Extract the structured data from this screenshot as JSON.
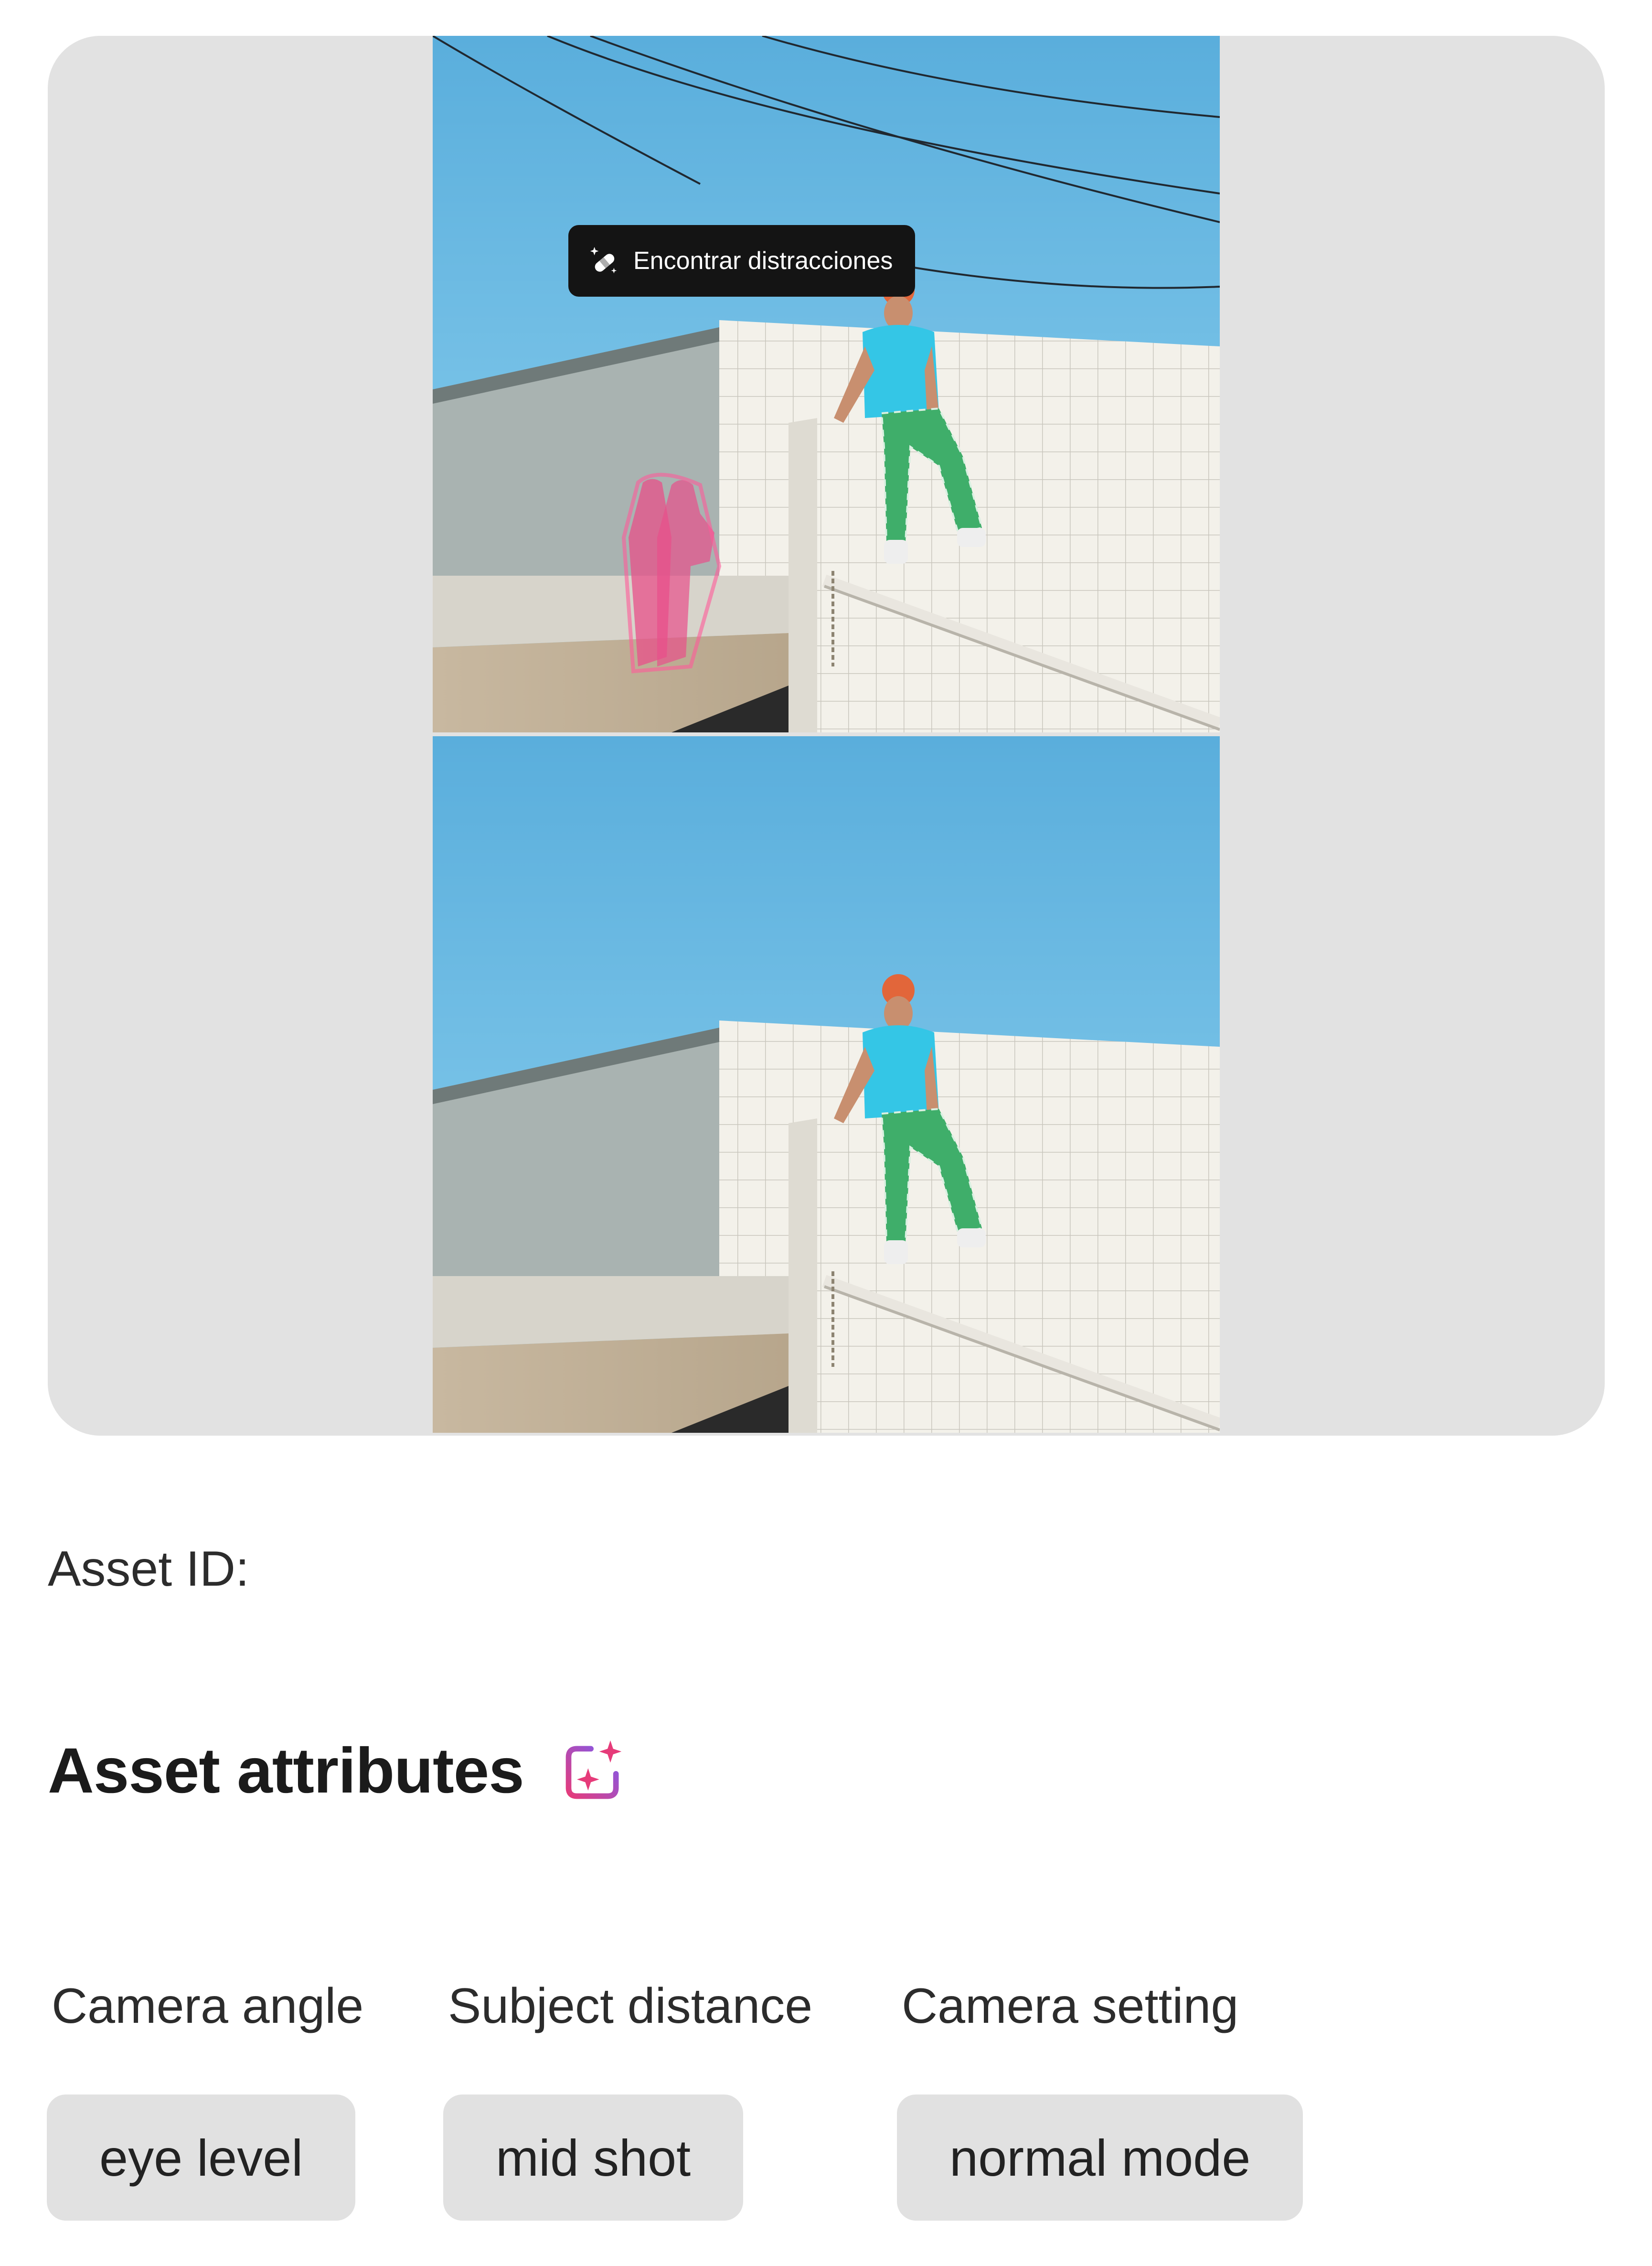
{
  "tooltip": {
    "label": "Encontrar distracciones",
    "icon": "bandage-sparkle-icon"
  },
  "asset": {
    "id_label": "Asset ID:"
  },
  "attributes": {
    "heading": "Asset attributes",
    "heading_icon": "ai-sparkle-icon",
    "items": [
      {
        "label": "Camera angle",
        "value": "eye level"
      },
      {
        "label": "Subject distance",
        "value": "mid shot"
      },
      {
        "label": "Camera setting",
        "value": "normal mode"
      }
    ]
  },
  "colors": {
    "card_background": "#e2e2e2",
    "chip_background": "#e1e1e1",
    "sky": "#6fc3ec",
    "distraction_highlight": "#e8508a",
    "ai_icon_gradient": [
      "#e63b7a",
      "#7b5cf2"
    ]
  }
}
